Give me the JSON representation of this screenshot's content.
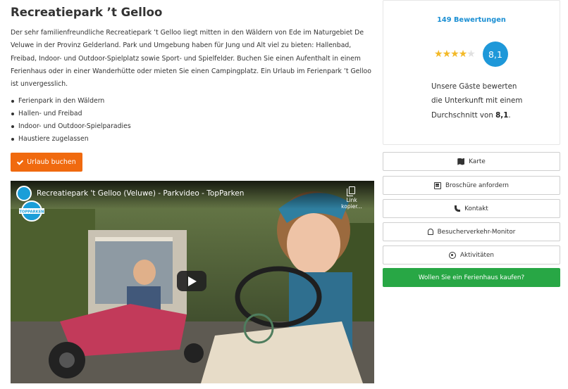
{
  "park": {
    "title": "Recreatiepark ’t Gelloo",
    "description": "Der sehr familienfreundliche Recreatiepark ’t Gelloo liegt mitten in den Wäldern von Ede im Naturgebiet De Veluwe in der Provinz Gelderland. Park und Umgebung haben für Jung und Alt viel zu bieten: Hallenbad, Freibad, Indoor- und Outdoor-Spielplatz sowie Sport- und Spielfelder. Buchen Sie einen Aufenthalt in einem Ferienhaus oder in einer Wanderhütte oder mieten Sie einen Campingplatz. Ein Urlaub im Ferienpark ’t Gelloo ist unvergesslich.",
    "features": [
      "Ferienpark in den Wäldern",
      "Hallen- und Freibad",
      "Indoor- und Outdoor-Spielparadies",
      "Haustiere zugelassen"
    ],
    "book_button": "Urlaub buchen"
  },
  "video": {
    "title": "Recreatiepark 't Gelloo (Veluwe) - Parkvideo - TopParken",
    "copy_label": "Link kopier...",
    "watermark": "TOPPARKEN",
    "play_icon": "play-icon"
  },
  "rating": {
    "count_label": "149 Bewertungen",
    "score": "8,1",
    "stars_value": 4,
    "stars_max": 5,
    "text_before": "Unsere Gäste bewerten die Unterkunft mit einem Durchschnitt von",
    "text_score": "8,1",
    "text_after": "."
  },
  "sidebar_buttons": [
    {
      "label": "Karte",
      "icon": "map-icon"
    },
    {
      "label": "Broschüre anfordern",
      "icon": "newspaper-icon"
    },
    {
      "label": "Kontakt",
      "icon": "phone-icon"
    },
    {
      "label": "Besucherverkehr-Monitor",
      "icon": "bell-icon"
    },
    {
      "label": "Aktivitäten",
      "icon": "football-icon"
    }
  ],
  "buy_button": "Wollen Sie ein Ferienhaus kaufen?",
  "colors": {
    "book_button": "#f06a0f",
    "rating_accent": "#1e98d9",
    "buy_button": "#28a745",
    "stars": "#f3b928"
  }
}
